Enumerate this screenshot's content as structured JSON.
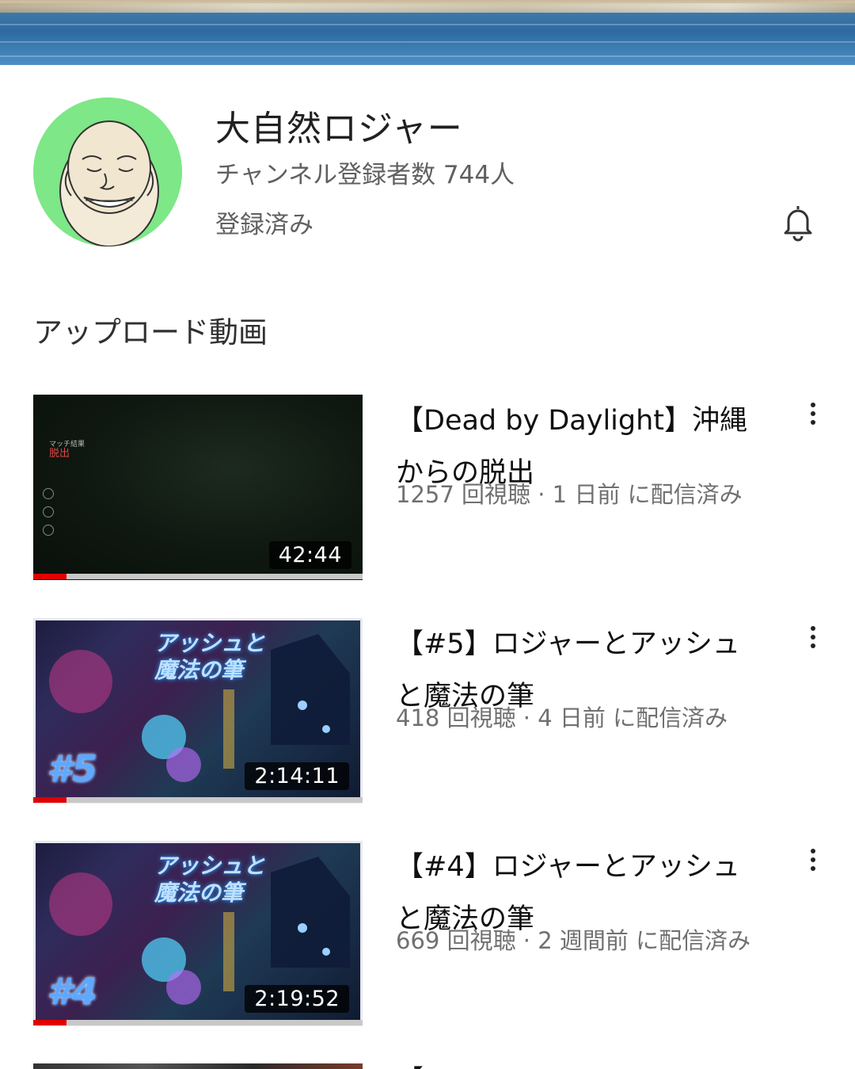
{
  "channel": {
    "name": "大自然ロジャー",
    "subscribers": "チャンネル登録者数 744人",
    "subscribed_label": "登録済み"
  },
  "section_title": "アップロード動画",
  "videos": [
    {
      "title": "【Dead by Daylight】沖縄からの脱出",
      "meta": "1257 回視聴 · 1 日前 に配信済み",
      "duration": "42:44",
      "watched_fraction": 0.1,
      "thumb": {
        "style": "dark",
        "label_top": "マッチ結果",
        "label_main": "脱出"
      }
    },
    {
      "title": "【#5】ロジャーとアッシュと魔法の筆",
      "meta": "418 回視聴 · 4 日前 に配信済み",
      "duration": "2:14:11",
      "watched_fraction": 0.1,
      "thumb": {
        "style": "ashe",
        "title_text": "アッシュと魔法の筆",
        "episode": "#5"
      }
    },
    {
      "title": "【#4】ロジャーとアッシュと魔法の筆",
      "meta": "669 回視聴 · 2 週間前 に配信済み",
      "duration": "2:19:52",
      "watched_fraction": 0.1,
      "thumb": {
        "style": "ashe",
        "title_text": "アッシュと魔法の筆",
        "episode": "#4"
      }
    }
  ],
  "next_video_partial_title": "【",
  "colors": {
    "progress": "#e00000",
    "avatar_bg": "#7ee787"
  },
  "icons": [
    "bell-icon",
    "more-vert-icon"
  ]
}
